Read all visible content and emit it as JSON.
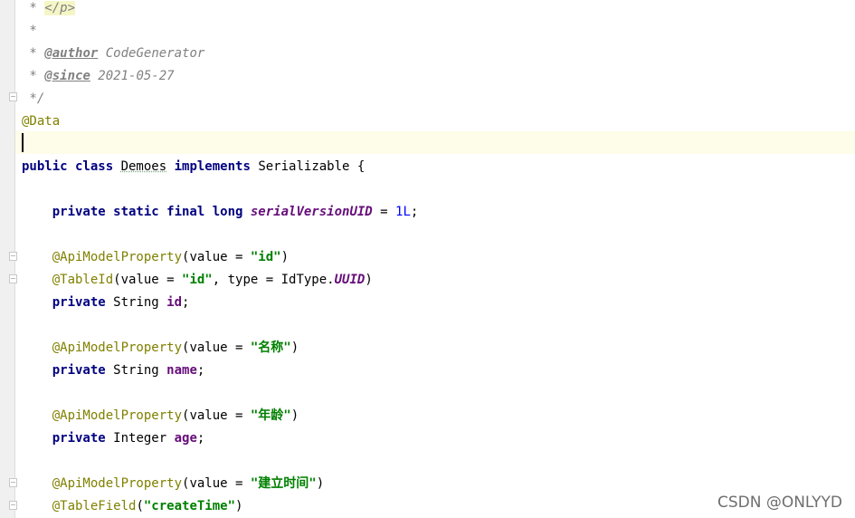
{
  "editor": {
    "lines": [
      {
        "tokens": [
          {
            "t": "doc",
            "v": " * "
          },
          {
            "t": "tag",
            "v": "</p>"
          }
        ]
      },
      {
        "tokens": [
          {
            "t": "doc",
            "v": " *"
          }
        ]
      },
      {
        "tokens": [
          {
            "t": "doc",
            "v": " * "
          },
          {
            "t": "doctag",
            "v": "@author"
          },
          {
            "t": "doc",
            "v": " CodeGenerator"
          }
        ]
      },
      {
        "tokens": [
          {
            "t": "doc",
            "v": " * "
          },
          {
            "t": "doctag",
            "v": "@since"
          },
          {
            "t": "doc",
            "v": " 2021-05-27"
          }
        ]
      },
      {
        "tokens": [
          {
            "t": "doc",
            "v": " */"
          }
        ]
      },
      {
        "tokens": [
          {
            "t": "ann",
            "v": "@Data"
          }
        ]
      },
      {
        "tokens": []
      },
      {
        "tokens": [
          {
            "t": "kw",
            "v": "public class "
          },
          {
            "t": "squiggle",
            "v": "Demoes"
          },
          {
            "t": "plain",
            "v": " "
          },
          {
            "t": "kw",
            "v": "implements"
          },
          {
            "t": "plain",
            "v": " Serializable {"
          }
        ]
      },
      {
        "tokens": []
      },
      {
        "tokens": [
          {
            "t": "plain",
            "v": "    "
          },
          {
            "t": "kw",
            "v": "private static final long "
          },
          {
            "t": "static",
            "v": "serialVersionUID"
          },
          {
            "t": "plain",
            "v": " = "
          },
          {
            "t": "num",
            "v": "1L"
          },
          {
            "t": "plain",
            "v": ";"
          }
        ]
      },
      {
        "tokens": []
      },
      {
        "tokens": [
          {
            "t": "plain",
            "v": "    "
          },
          {
            "t": "ann",
            "v": "@ApiModelProperty"
          },
          {
            "t": "plain",
            "v": "(value = "
          },
          {
            "t": "str",
            "v": "\"id\""
          },
          {
            "t": "plain",
            "v": ")"
          }
        ]
      },
      {
        "tokens": [
          {
            "t": "plain",
            "v": "    "
          },
          {
            "t": "ann",
            "v": "@TableId"
          },
          {
            "t": "plain",
            "v": "(value = "
          },
          {
            "t": "str",
            "v": "\"id\""
          },
          {
            "t": "plain",
            "v": ", type = IdType."
          },
          {
            "t": "static",
            "v": "UUID"
          },
          {
            "t": "plain",
            "v": ")"
          }
        ]
      },
      {
        "tokens": [
          {
            "t": "plain",
            "v": "    "
          },
          {
            "t": "kw",
            "v": "private"
          },
          {
            "t": "plain",
            "v": " String "
          },
          {
            "t": "field",
            "v": "id"
          },
          {
            "t": "plain",
            "v": ";"
          }
        ]
      },
      {
        "tokens": []
      },
      {
        "tokens": [
          {
            "t": "plain",
            "v": "    "
          },
          {
            "t": "ann",
            "v": "@ApiModelProperty"
          },
          {
            "t": "plain",
            "v": "(value = "
          },
          {
            "t": "str",
            "v": "\"名称\""
          },
          {
            "t": "plain",
            "v": ")"
          }
        ]
      },
      {
        "tokens": [
          {
            "t": "plain",
            "v": "    "
          },
          {
            "t": "kw",
            "v": "private"
          },
          {
            "t": "plain",
            "v": " String "
          },
          {
            "t": "field",
            "v": "name"
          },
          {
            "t": "plain",
            "v": ";"
          }
        ]
      },
      {
        "tokens": []
      },
      {
        "tokens": [
          {
            "t": "plain",
            "v": "    "
          },
          {
            "t": "ann",
            "v": "@ApiModelProperty"
          },
          {
            "t": "plain",
            "v": "(value = "
          },
          {
            "t": "str",
            "v": "\"年龄\""
          },
          {
            "t": "plain",
            "v": ")"
          }
        ]
      },
      {
        "tokens": [
          {
            "t": "plain",
            "v": "    "
          },
          {
            "t": "kw",
            "v": "private"
          },
          {
            "t": "plain",
            "v": " Integer "
          },
          {
            "t": "field",
            "v": "age"
          },
          {
            "t": "plain",
            "v": ";"
          }
        ]
      },
      {
        "tokens": []
      },
      {
        "tokens": [
          {
            "t": "plain",
            "v": "    "
          },
          {
            "t": "ann",
            "v": "@ApiModelProperty"
          },
          {
            "t": "plain",
            "v": "(value = "
          },
          {
            "t": "str",
            "v": "\"建立时间\""
          },
          {
            "t": "plain",
            "v": ")"
          }
        ]
      },
      {
        "tokens": [
          {
            "t": "plain",
            "v": "    "
          },
          {
            "t": "ann",
            "v": "@TableField"
          },
          {
            "t": "plain",
            "v": "("
          },
          {
            "t": "str",
            "v": "\"createTime\""
          },
          {
            "t": "plain",
            "v": ")"
          }
        ]
      }
    ]
  },
  "watermark": "CSDN @ONLYYD"
}
